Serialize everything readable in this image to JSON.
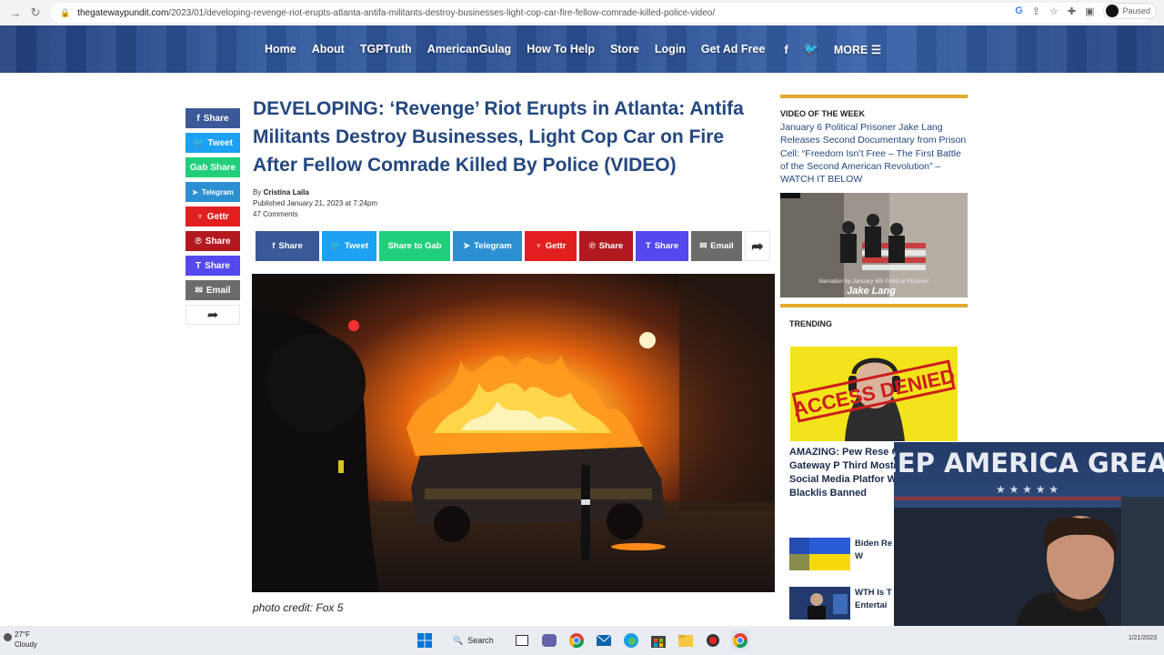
{
  "browser": {
    "url_host": "thegatewaypundit.com",
    "url_path": "/2023/01/developing-revenge-riot-erupts-atlanta-antifa-militants-destroy-businesses-light-cop-car-fire-fellow-comrade-killed-police-video/",
    "profile_status": "Paused"
  },
  "nav": {
    "items": [
      "Home",
      "About",
      "TGPTruth",
      "AmericanGulag",
      "How To Help",
      "Store",
      "Login",
      "Get Ad Free"
    ],
    "more": "MORE"
  },
  "share_side": [
    "Share",
    "Tweet",
    "Gab Share",
    "Telegram",
    "Gettr",
    "Share",
    "Share",
    "Email"
  ],
  "article": {
    "title": "DEVELOPING: ‘Revenge’ Riot Erupts in Atlanta: Antifa Militants Destroy Businesses, Light Cop Car on Fire After Fellow Comrade Killed By Police (VIDEO)",
    "by_prefix": "By",
    "author": "Cristina Laila",
    "published": "Published January 21, 2023 at 7:24pm",
    "comments": "47 Comments",
    "share_bar": [
      "Share",
      "Tweet",
      "Share to Gab",
      "Telegram",
      "Gettr",
      "Share",
      "Share",
      "Email"
    ],
    "photo_credit": "photo credit: Fox 5"
  },
  "sidebar": {
    "vow_label": "VIDEO OF THE WEEK",
    "vow_text": "January 6 Political Prisoner Jake Lang Releases Second Documentary from Prison Cell: “Freedom Isn’t Free – The First Battle of the Second American Revolution” – WATCH IT BELOW",
    "vow_caption_small": "Narration by January 6th Political Prisoner",
    "vow_caption_name": "Jake Lang",
    "trending_label": "TRENDING",
    "trend_stamp": "ACCESS DENIED",
    "trend_headline": "AMAZING: Pew Rese Confirms Gateway P Third Most Linked W Social Media Platfor We Are Not Blacklis Banned",
    "mini_items": [
      {
        "text": "Biden Re Announ Billion W"
      },
      {
        "text": "WTH Is T Economi Entertai"
      }
    ]
  },
  "webcam": {
    "banner_text": "EEP AMERICA GREAT"
  },
  "taskbar": {
    "temp": "27°F",
    "condition": "Cloudy",
    "search": "Search",
    "date": "1/21/2023"
  },
  "colors": {
    "title_blue": "#23477f",
    "accent_gold": "#e2a92c",
    "facebook": "#3b5998",
    "twitter": "#1da1f2",
    "gab": "#21cf7a",
    "telegram": "#2c8fd1",
    "gettr": "#e21f1f",
    "parler": "#b1191f",
    "truth": "#5448ee",
    "email": "#6b6b6b"
  }
}
